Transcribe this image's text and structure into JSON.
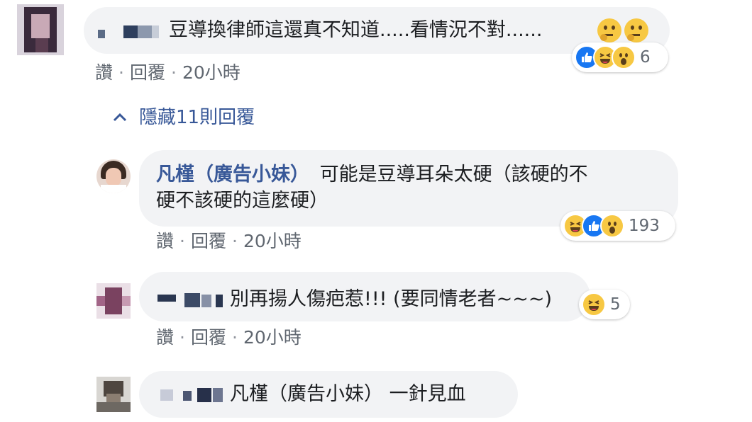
{
  "comments": [
    {
      "author": "",
      "text": "豆導換律師這還真不知道.....看情況不對......",
      "actions": {
        "like": "讚",
        "reply": "回覆",
        "time": "20小時"
      },
      "reactions": {
        "icons": [
          "like-icon",
          "haha-icon",
          "wow-icon"
        ],
        "count": "6"
      }
    },
    {
      "author": "凡槿（廣告小妹）",
      "text_line1": "可能是豆導耳朵太硬（該硬的不",
      "text_line2": "硬不該硬的這麼硬）",
      "actions": {
        "like": "讚",
        "reply": "回覆",
        "time": "20小時"
      },
      "reactions": {
        "icons": [
          "haha-icon",
          "like-icon",
          "wow-icon"
        ],
        "count": "193"
      }
    },
    {
      "author": "",
      "text": "別再揚人傷疤惹!!! (要同情老者~~~)",
      "actions": {
        "like": "讚",
        "reply": "回覆",
        "time": "20小時"
      },
      "reactions": {
        "icons": [
          "haha-icon"
        ],
        "count": "5"
      }
    },
    {
      "author": "",
      "text": "凡槿（廣告小妹） 一針見血"
    }
  ],
  "hide_replies": {
    "label": "隱藏11則回覆",
    "icon": "chevron-up-icon"
  },
  "colors": {
    "author": "#385898",
    "bubble": "#f2f3f5",
    "meta": "#606770",
    "like": "#1877f2",
    "emoji": "#f7c843"
  }
}
